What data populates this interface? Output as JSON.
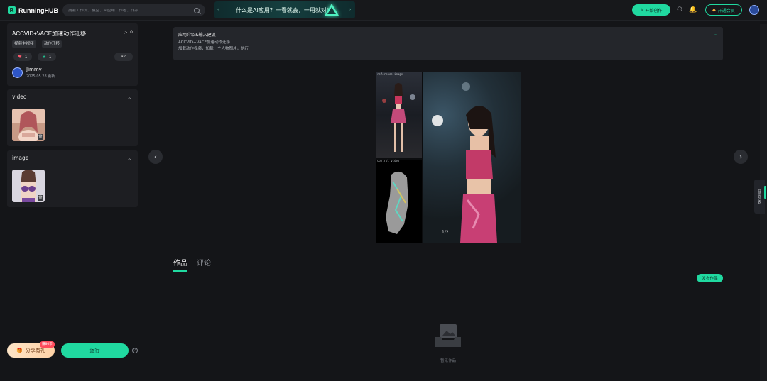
{
  "header": {
    "logo_text": "RunningHUB",
    "search_placeholder": "搜索工作流、模型、AI应用、作者、作品",
    "banner_text": "什么是AI应用？一看就会，一用就对！",
    "create_label": "开始创作",
    "vip_label": "开通会员"
  },
  "app": {
    "title": "ACCVID+VACE加速动作迁移",
    "run_count": "0",
    "tags": [
      "视频生视频",
      "动作迁移"
    ],
    "likes": "1",
    "favorites": "1",
    "api_label": "API",
    "author": "Jimmy",
    "updated": "2025.05.28 更新"
  },
  "sections": {
    "video_label": "video",
    "image_label": "image"
  },
  "bottom": {
    "share_label": "分享有礼",
    "share_badge": "赚80币",
    "run_label": "运行"
  },
  "description": {
    "title": "应用介绍&输入建议",
    "lines": [
      "ACCVID+VACE加速动作迁移",
      "加载动作视频，加载一个人物图片，执行"
    ]
  },
  "gallery": {
    "label_top": "reference image",
    "label_mid": "control_video",
    "counter": "1/2"
  },
  "tabs": [
    {
      "label": "作品",
      "active": true
    },
    {
      "label": "评论",
      "active": false
    }
  ],
  "works": {
    "publish_label": "发布作品",
    "empty_text": "暂无作品"
  },
  "side_tab": "任务列表",
  "colors": {
    "accent": "#20d9a0",
    "background": "#141518",
    "card": "#1d1e22"
  }
}
